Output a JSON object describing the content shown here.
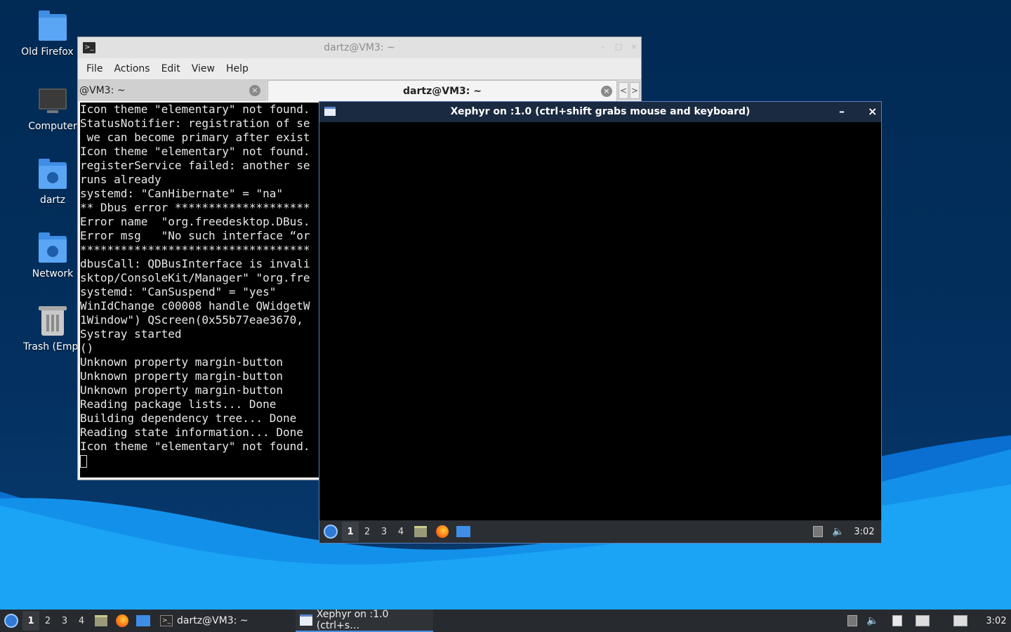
{
  "desktop": {
    "icons": [
      {
        "label": "Old Firefox D",
        "icon": "folder-icon"
      },
      {
        "label": "Computer",
        "icon": "computer-icon"
      },
      {
        "label": "dartz",
        "icon": "home-folder-icon"
      },
      {
        "label": "Network",
        "icon": "network-folder-icon"
      },
      {
        "label": "Trash (Empt",
        "icon": "trash-icon"
      }
    ],
    "colors": {
      "wallpaper_dark": "#012a55",
      "wave_light": "#1aa0f0",
      "wave_mid": "#0a78d8"
    }
  },
  "terminal": {
    "title": "dartz@VM3: ~",
    "menu": [
      "File",
      "Actions",
      "Edit",
      "View",
      "Help"
    ],
    "tabs": [
      {
        "label": "@VM3: ~",
        "close": "×"
      },
      {
        "label": "dartz@VM3: ~",
        "close": "×"
      }
    ],
    "scroll_left": "<",
    "scroll_right": ">",
    "lines": [
      "Icon theme \"elementary\" not found.",
      "StatusNotifier: registration of se",
      " we can become primary after exist",
      "Icon theme \"elementary\" not found.",
      "registerService failed: another se",
      "runs already",
      "systemd: \"CanHibernate\" = \"na\"",
      "** Dbus error ********************",
      "Error name  \"org.freedesktop.DBus.",
      "Error msg   \"No such interface “or",
      "**********************************",
      "dbusCall: QDBusInterface is invali",
      "sktop/ConsoleKit/Manager\" \"org.fre",
      "systemd: \"CanSuspend\" = \"yes\"",
      "WinIdChange c00008 handle QWidgetW",
      "1Window\") QScreen(0x55b77eae3670,",
      "Systray started",
      "()",
      "Unknown property margin-button",
      "Unknown property margin-button",
      "Unknown property margin-button",
      "Reading package lists... Done",
      "Building dependency tree... Done",
      "Reading state information... Done",
      "Icon theme \"elementary\" not found."
    ]
  },
  "xephyr": {
    "title": "Xephyr on :1.0 (ctrl+shift grabs mouse and keyboard)",
    "minimize": "–",
    "close": "×",
    "panel": {
      "workspaces": [
        "1",
        "2",
        "3",
        "4"
      ],
      "active_workspace": "1",
      "clock": "3:02"
    }
  },
  "taskbar": {
    "workspaces": [
      "1",
      "2",
      "3",
      "4"
    ],
    "active_workspace": "1",
    "tasks": [
      {
        "label": "dartz@VM3: ~",
        "icon": "terminal-icon"
      },
      {
        "label": "Xephyr on :1.0 (ctrl+s…",
        "icon": "xephyr-window-icon",
        "active": true
      }
    ],
    "clock": "3:02"
  }
}
